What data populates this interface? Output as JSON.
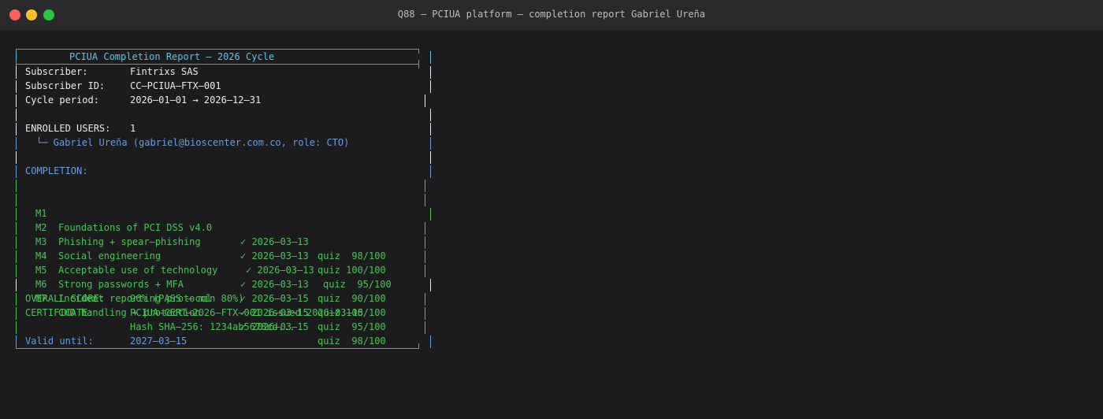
{
  "window": {
    "title": "Q88 — PCIUA platform — completion report Gabriel Ureña"
  },
  "report": {
    "header": "PCIUA Completion Report — 2026 Cycle",
    "subscriber_label": "Subscriber:",
    "subscriber_value": "Fintrixs SAS",
    "subscriber_id_label": "Subscriber ID:",
    "subscriber_id_value": "CC—PCIUA—FTX—001",
    "cycle_label": "Cycle period:",
    "cycle_value": "2026—01—01 → 2026—12—31",
    "enrolled_label": "ENROLLED USERS:",
    "enrolled_value": "1",
    "user_line": "└─ Gabriel Ureña (gabriel@bioscenter.com.co, role: CTO)",
    "completion_label": "COMPLETION:",
    "modules": [
      {
        "code": "M1",
        "name": "Foundations of PCI DSS v4.0",
        "date": "✓ 2026—03—13",
        "quiz": "quiz  98/100"
      },
      {
        "code": "M2",
        "name": "Phishing + spear—phishing",
        "date": "✓ 2026—03—13",
        "quiz": "quiz 100/100"
      },
      {
        "code": "M3",
        "name": "Social engineering",
        "date": "✓ 2026—03—13",
        "quiz": "quiz  95/100"
      },
      {
        "code": "M4",
        "name": "Acceptable use of technology",
        "date": "✓ 2026—03—13",
        "quiz": "quiz  90/100"
      },
      {
        "code": "M5",
        "name": "Strong passwords + MFA",
        "date": "✓ 2026—03—15",
        "quiz": "quiz 100/100"
      },
      {
        "code": "M6",
        "name": "Incident reporting protocol",
        "date": "✓ 2026—03—15",
        "quiz": "quiz  95/100"
      },
      {
        "code": "M7",
        "name": "CHD handling + protection",
        "date": "✓ 2026—03—15",
        "quiz": "quiz  98/100"
      }
    ],
    "overall_label": "OVERALL SCORE:",
    "overall_value": "96% (PASS — min 80%)",
    "certificate_label": "CERTIFICATE:",
    "certificate_value": "PCIUA—CERT—2026—FTX—001 issued 2026—03—15",
    "hash_value": "Hash SHA—256: 1234ab5678cd...",
    "valid_label": "Valid until:",
    "valid_value": "2027—03—15"
  }
}
